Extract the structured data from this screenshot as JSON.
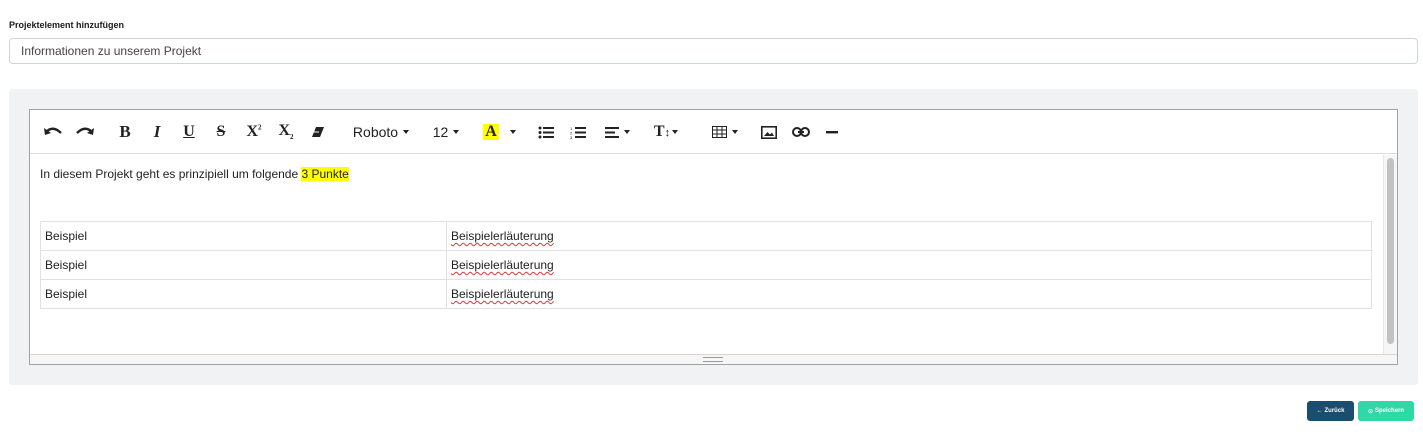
{
  "form": {
    "label": "Projektelement hinzufügen",
    "title_value": "Informationen zu unserem Projekt"
  },
  "toolbar": {
    "font_name": "Roboto",
    "font_size": "12",
    "highlight_color": "#ffff00",
    "items": [
      "undo-icon",
      "redo-icon",
      "bold-icon",
      "italic-icon",
      "underline-icon",
      "strikethrough-icon",
      "superscript-icon",
      "subscript-icon",
      "eraser-icon",
      "font-family-select",
      "font-size-select",
      "highlight-color-icon",
      "unordered-list-icon",
      "ordered-list-icon",
      "align-icon",
      "line-height-icon",
      "table-icon",
      "image-icon",
      "link-icon",
      "horizontal-rule-icon"
    ]
  },
  "editor": {
    "intro_text": "In diesem Projekt geht es prinzipiell um folgende ",
    "intro_highlight": "3 Punkte",
    "table": [
      [
        "Beispiel",
        "Beispielerläuterung"
      ],
      [
        "Beispiel",
        "Beispielerläuterung"
      ],
      [
        "Beispiel",
        "Beispielerläuterung"
      ]
    ]
  },
  "actions": {
    "back_label": "Zurück",
    "save_label": "Speichern",
    "back_color": "#1b4d6e",
    "save_color": "#2fd9a7"
  }
}
